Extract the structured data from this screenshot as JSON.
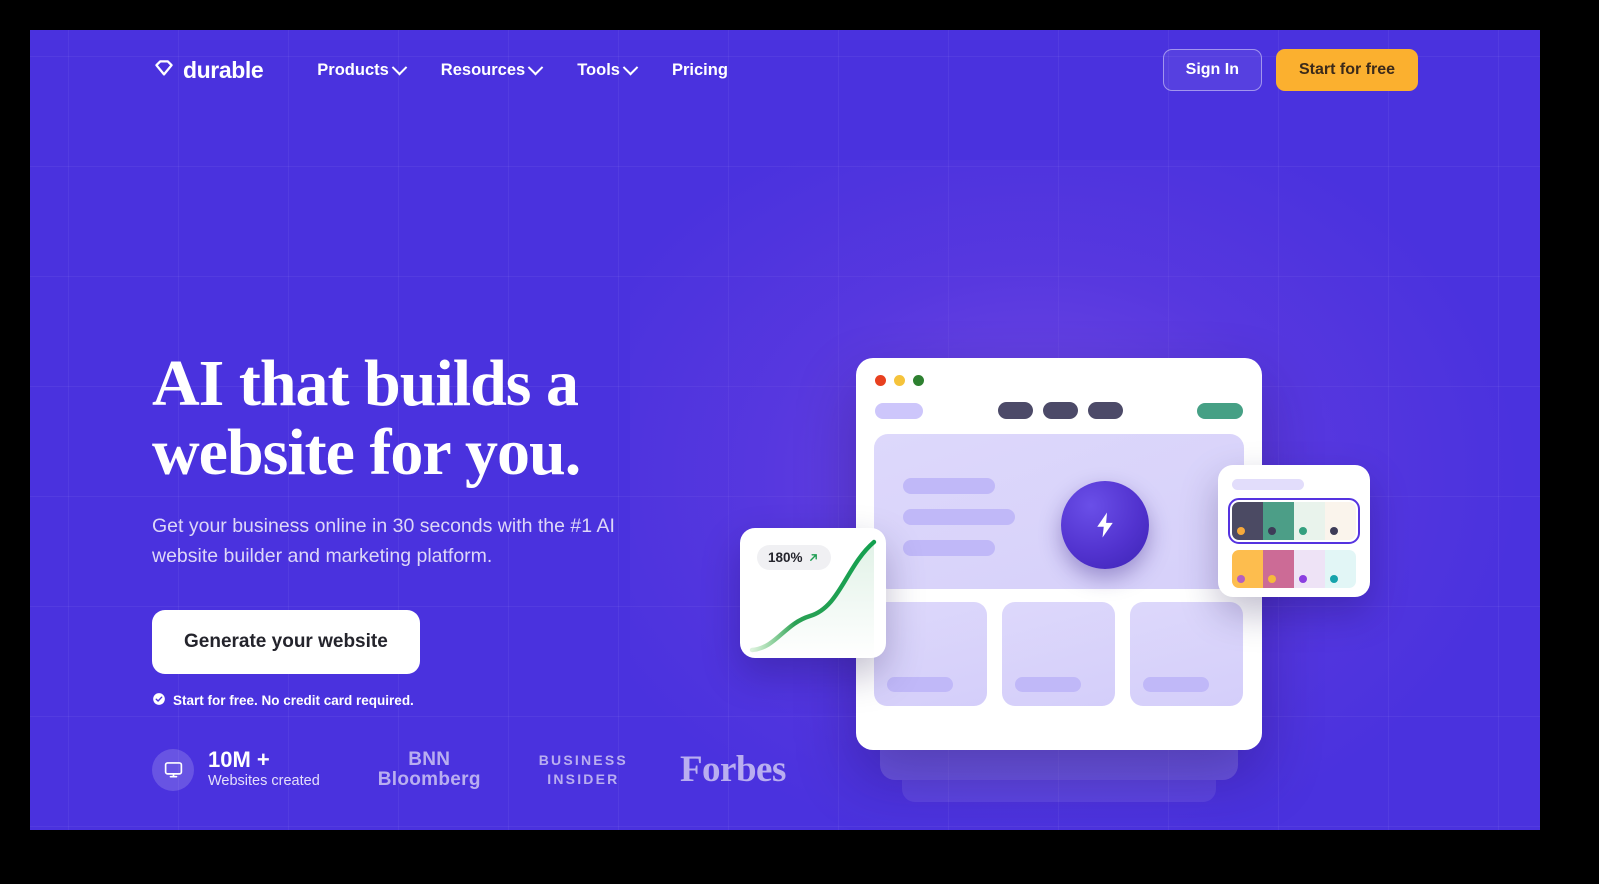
{
  "theme": {
    "background": "#4a32de",
    "accent_amber": "#fbb02f",
    "accent_green": "#1f9e53",
    "letterbox": "#000000"
  },
  "nav": {
    "logo": {
      "icon": "diamond-logo-icon",
      "word": "durable"
    },
    "links": [
      {
        "label": "Products",
        "has_caret": true
      },
      {
        "label": "Resources",
        "has_caret": true
      },
      {
        "label": "Tools",
        "has_caret": true
      },
      {
        "label": "Pricing",
        "has_caret": false
      }
    ],
    "sign_in": "Sign In",
    "start_free": "Start for free"
  },
  "hero": {
    "headline_line1": "AI that builds a",
    "headline_line2": "website for you.",
    "subhead": "Get your business online in 30 seconds with the #1 AI website builder and marketing platform.",
    "cta": "Generate your website",
    "trust_note": "Start for free. No credit card required.",
    "trust_icon": "check-circle-icon"
  },
  "stats": {
    "icon": "monitor-icon",
    "value": "10M +",
    "label": "Websites created"
  },
  "press": [
    {
      "name": "bnn-bloomberg",
      "line1": "BNN",
      "line2": "Bloomberg"
    },
    {
      "name": "business-insider",
      "line1": "BUSINESS",
      "line2": "INSIDER"
    },
    {
      "name": "forbes",
      "line1": "Forbes"
    }
  ],
  "illustration": {
    "browser": {
      "traffic_lights": [
        "#e8401f",
        "#f5c33b",
        "#2d8030"
      ],
      "nav_pill_count": 3,
      "card_count": 3
    },
    "chart_card": {
      "badge_value": "180%",
      "badge_icon": "arrow-up-right-icon",
      "line_color": "#1f9e53"
    },
    "palette_card": {
      "rows": [
        {
          "selected": true,
          "swatches": [
            {
              "fill": "#4b4a63",
              "dot": "#f6a93b"
            },
            {
              "fill": "#4c9e87",
              "dot": "#3d3c58"
            },
            {
              "fill": "#e9f3ec",
              "dot": "#33a07f"
            },
            {
              "fill": "#faf4ec",
              "dot": "#3d3c58"
            }
          ]
        },
        {
          "selected": false,
          "swatches": [
            {
              "fill": "#fdbd4e",
              "dot": "#b45fc0"
            },
            {
              "fill": "#cc6b96",
              "dot": "#f6b93b"
            },
            {
              "fill": "#eee3f6",
              "dot": "#8b3fe0"
            },
            {
              "fill": "#e2f6f6",
              "dot": "#16a3ab"
            }
          ]
        }
      ]
    }
  }
}
